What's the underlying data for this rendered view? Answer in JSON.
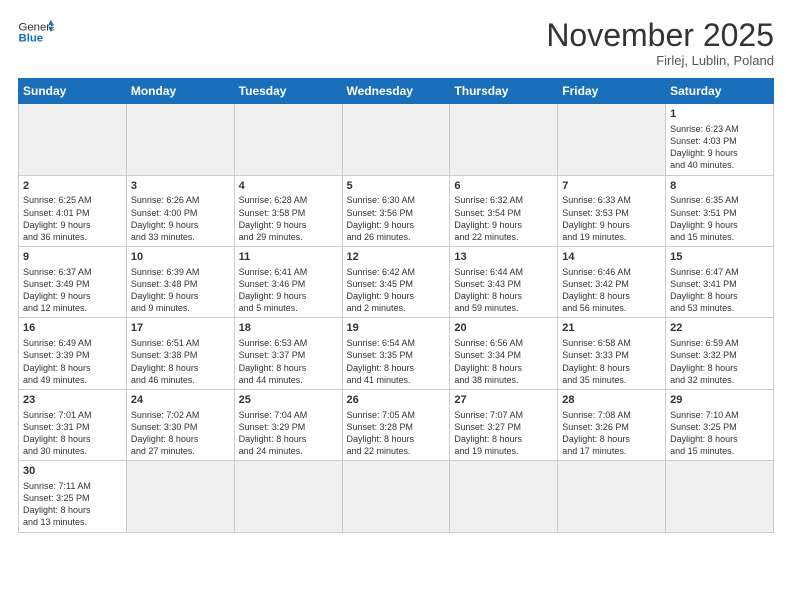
{
  "header": {
    "logo_general": "General",
    "logo_blue": "Blue",
    "month_title": "November 2025",
    "location": "Firlej, Lublin, Poland"
  },
  "weekdays": [
    "Sunday",
    "Monday",
    "Tuesday",
    "Wednesday",
    "Thursday",
    "Friday",
    "Saturday"
  ],
  "weeks": [
    [
      {
        "day": "",
        "info": ""
      },
      {
        "day": "",
        "info": ""
      },
      {
        "day": "",
        "info": ""
      },
      {
        "day": "",
        "info": ""
      },
      {
        "day": "",
        "info": ""
      },
      {
        "day": "",
        "info": ""
      },
      {
        "day": "1",
        "info": "Sunrise: 6:23 AM\nSunset: 4:03 PM\nDaylight: 9 hours\nand 40 minutes."
      }
    ],
    [
      {
        "day": "2",
        "info": "Sunrise: 6:25 AM\nSunset: 4:01 PM\nDaylight: 9 hours\nand 36 minutes."
      },
      {
        "day": "3",
        "info": "Sunrise: 6:26 AM\nSunset: 4:00 PM\nDaylight: 9 hours\nand 33 minutes."
      },
      {
        "day": "4",
        "info": "Sunrise: 6:28 AM\nSunset: 3:58 PM\nDaylight: 9 hours\nand 29 minutes."
      },
      {
        "day": "5",
        "info": "Sunrise: 6:30 AM\nSunset: 3:56 PM\nDaylight: 9 hours\nand 26 minutes."
      },
      {
        "day": "6",
        "info": "Sunrise: 6:32 AM\nSunset: 3:54 PM\nDaylight: 9 hours\nand 22 minutes."
      },
      {
        "day": "7",
        "info": "Sunrise: 6:33 AM\nSunset: 3:53 PM\nDaylight: 9 hours\nand 19 minutes."
      },
      {
        "day": "8",
        "info": "Sunrise: 6:35 AM\nSunset: 3:51 PM\nDaylight: 9 hours\nand 15 minutes."
      }
    ],
    [
      {
        "day": "9",
        "info": "Sunrise: 6:37 AM\nSunset: 3:49 PM\nDaylight: 9 hours\nand 12 minutes."
      },
      {
        "day": "10",
        "info": "Sunrise: 6:39 AM\nSunset: 3:48 PM\nDaylight: 9 hours\nand 9 minutes."
      },
      {
        "day": "11",
        "info": "Sunrise: 6:41 AM\nSunset: 3:46 PM\nDaylight: 9 hours\nand 5 minutes."
      },
      {
        "day": "12",
        "info": "Sunrise: 6:42 AM\nSunset: 3:45 PM\nDaylight: 9 hours\nand 2 minutes."
      },
      {
        "day": "13",
        "info": "Sunrise: 6:44 AM\nSunset: 3:43 PM\nDaylight: 8 hours\nand 59 minutes."
      },
      {
        "day": "14",
        "info": "Sunrise: 6:46 AM\nSunset: 3:42 PM\nDaylight: 8 hours\nand 56 minutes."
      },
      {
        "day": "15",
        "info": "Sunrise: 6:47 AM\nSunset: 3:41 PM\nDaylight: 8 hours\nand 53 minutes."
      }
    ],
    [
      {
        "day": "16",
        "info": "Sunrise: 6:49 AM\nSunset: 3:39 PM\nDaylight: 8 hours\nand 49 minutes."
      },
      {
        "day": "17",
        "info": "Sunrise: 6:51 AM\nSunset: 3:38 PM\nDaylight: 8 hours\nand 46 minutes."
      },
      {
        "day": "18",
        "info": "Sunrise: 6:53 AM\nSunset: 3:37 PM\nDaylight: 8 hours\nand 44 minutes."
      },
      {
        "day": "19",
        "info": "Sunrise: 6:54 AM\nSunset: 3:35 PM\nDaylight: 8 hours\nand 41 minutes."
      },
      {
        "day": "20",
        "info": "Sunrise: 6:56 AM\nSunset: 3:34 PM\nDaylight: 8 hours\nand 38 minutes."
      },
      {
        "day": "21",
        "info": "Sunrise: 6:58 AM\nSunset: 3:33 PM\nDaylight: 8 hours\nand 35 minutes."
      },
      {
        "day": "22",
        "info": "Sunrise: 6:59 AM\nSunset: 3:32 PM\nDaylight: 8 hours\nand 32 minutes."
      }
    ],
    [
      {
        "day": "23",
        "info": "Sunrise: 7:01 AM\nSunset: 3:31 PM\nDaylight: 8 hours\nand 30 minutes."
      },
      {
        "day": "24",
        "info": "Sunrise: 7:02 AM\nSunset: 3:30 PM\nDaylight: 8 hours\nand 27 minutes."
      },
      {
        "day": "25",
        "info": "Sunrise: 7:04 AM\nSunset: 3:29 PM\nDaylight: 8 hours\nand 24 minutes."
      },
      {
        "day": "26",
        "info": "Sunrise: 7:05 AM\nSunset: 3:28 PM\nDaylight: 8 hours\nand 22 minutes."
      },
      {
        "day": "27",
        "info": "Sunrise: 7:07 AM\nSunset: 3:27 PM\nDaylight: 8 hours\nand 19 minutes."
      },
      {
        "day": "28",
        "info": "Sunrise: 7:08 AM\nSunset: 3:26 PM\nDaylight: 8 hours\nand 17 minutes."
      },
      {
        "day": "29",
        "info": "Sunrise: 7:10 AM\nSunset: 3:25 PM\nDaylight: 8 hours\nand 15 minutes."
      }
    ],
    [
      {
        "day": "30",
        "info": "Sunrise: 7:11 AM\nSunset: 3:25 PM\nDaylight: 8 hours\nand 13 minutes."
      },
      {
        "day": "",
        "info": ""
      },
      {
        "day": "",
        "info": ""
      },
      {
        "day": "",
        "info": ""
      },
      {
        "day": "",
        "info": ""
      },
      {
        "day": "",
        "info": ""
      },
      {
        "day": "",
        "info": ""
      }
    ]
  ]
}
